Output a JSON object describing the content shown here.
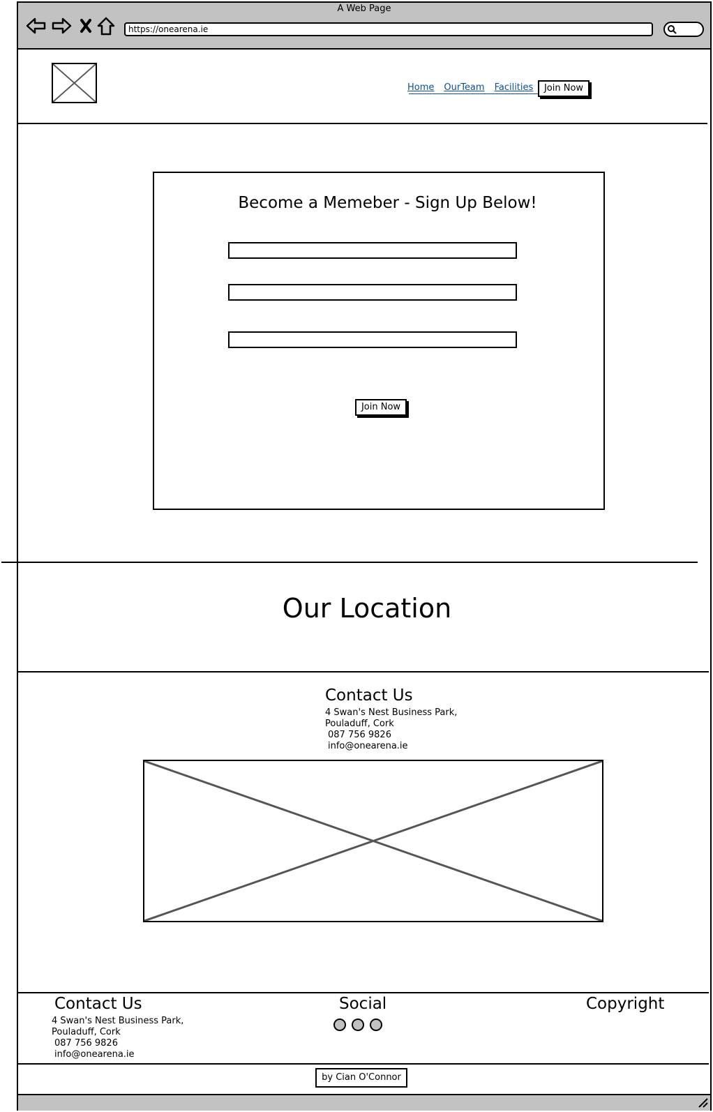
{
  "window": {
    "title": "A Web Page"
  },
  "browser": {
    "url": "https://onearena.ie"
  },
  "nav": {
    "items": [
      "Home",
      "OurTeam",
      "Facilities"
    ],
    "join_label": "Join Now"
  },
  "signup": {
    "title": "Become a Memeber - Sign Up Below!",
    "button_label": "Join Now"
  },
  "location": {
    "title": "Our Location"
  },
  "contact": {
    "heading": "Contact Us",
    "address_line1": "4 Swan's Nest Business Park,",
    "address_line2": "Pouladuff, Cork",
    "phone": "087 756 9826",
    "email": "info@onearena.ie"
  },
  "footer": {
    "contact_heading": "Contact Us",
    "address_line1": "4 Swan's Nest Business Park,",
    "address_line2": "Pouladuff, Cork",
    "phone": "087 756 9826",
    "email": "info@onearena.ie",
    "social_heading": "Social",
    "copyright_heading": "Copyright",
    "credit": "by Cian O'Connor"
  },
  "colors": {
    "chrome": "#c2c2c2",
    "link": "#0b4f9e",
    "line": "#000000",
    "placeholder_stroke": "#555555"
  },
  "icons": [
    "back-arrow-icon",
    "forward-arrow-icon",
    "stop-icon",
    "home-icon",
    "search-icon",
    "image-placeholder-icon",
    "resize-grip-icon"
  ]
}
